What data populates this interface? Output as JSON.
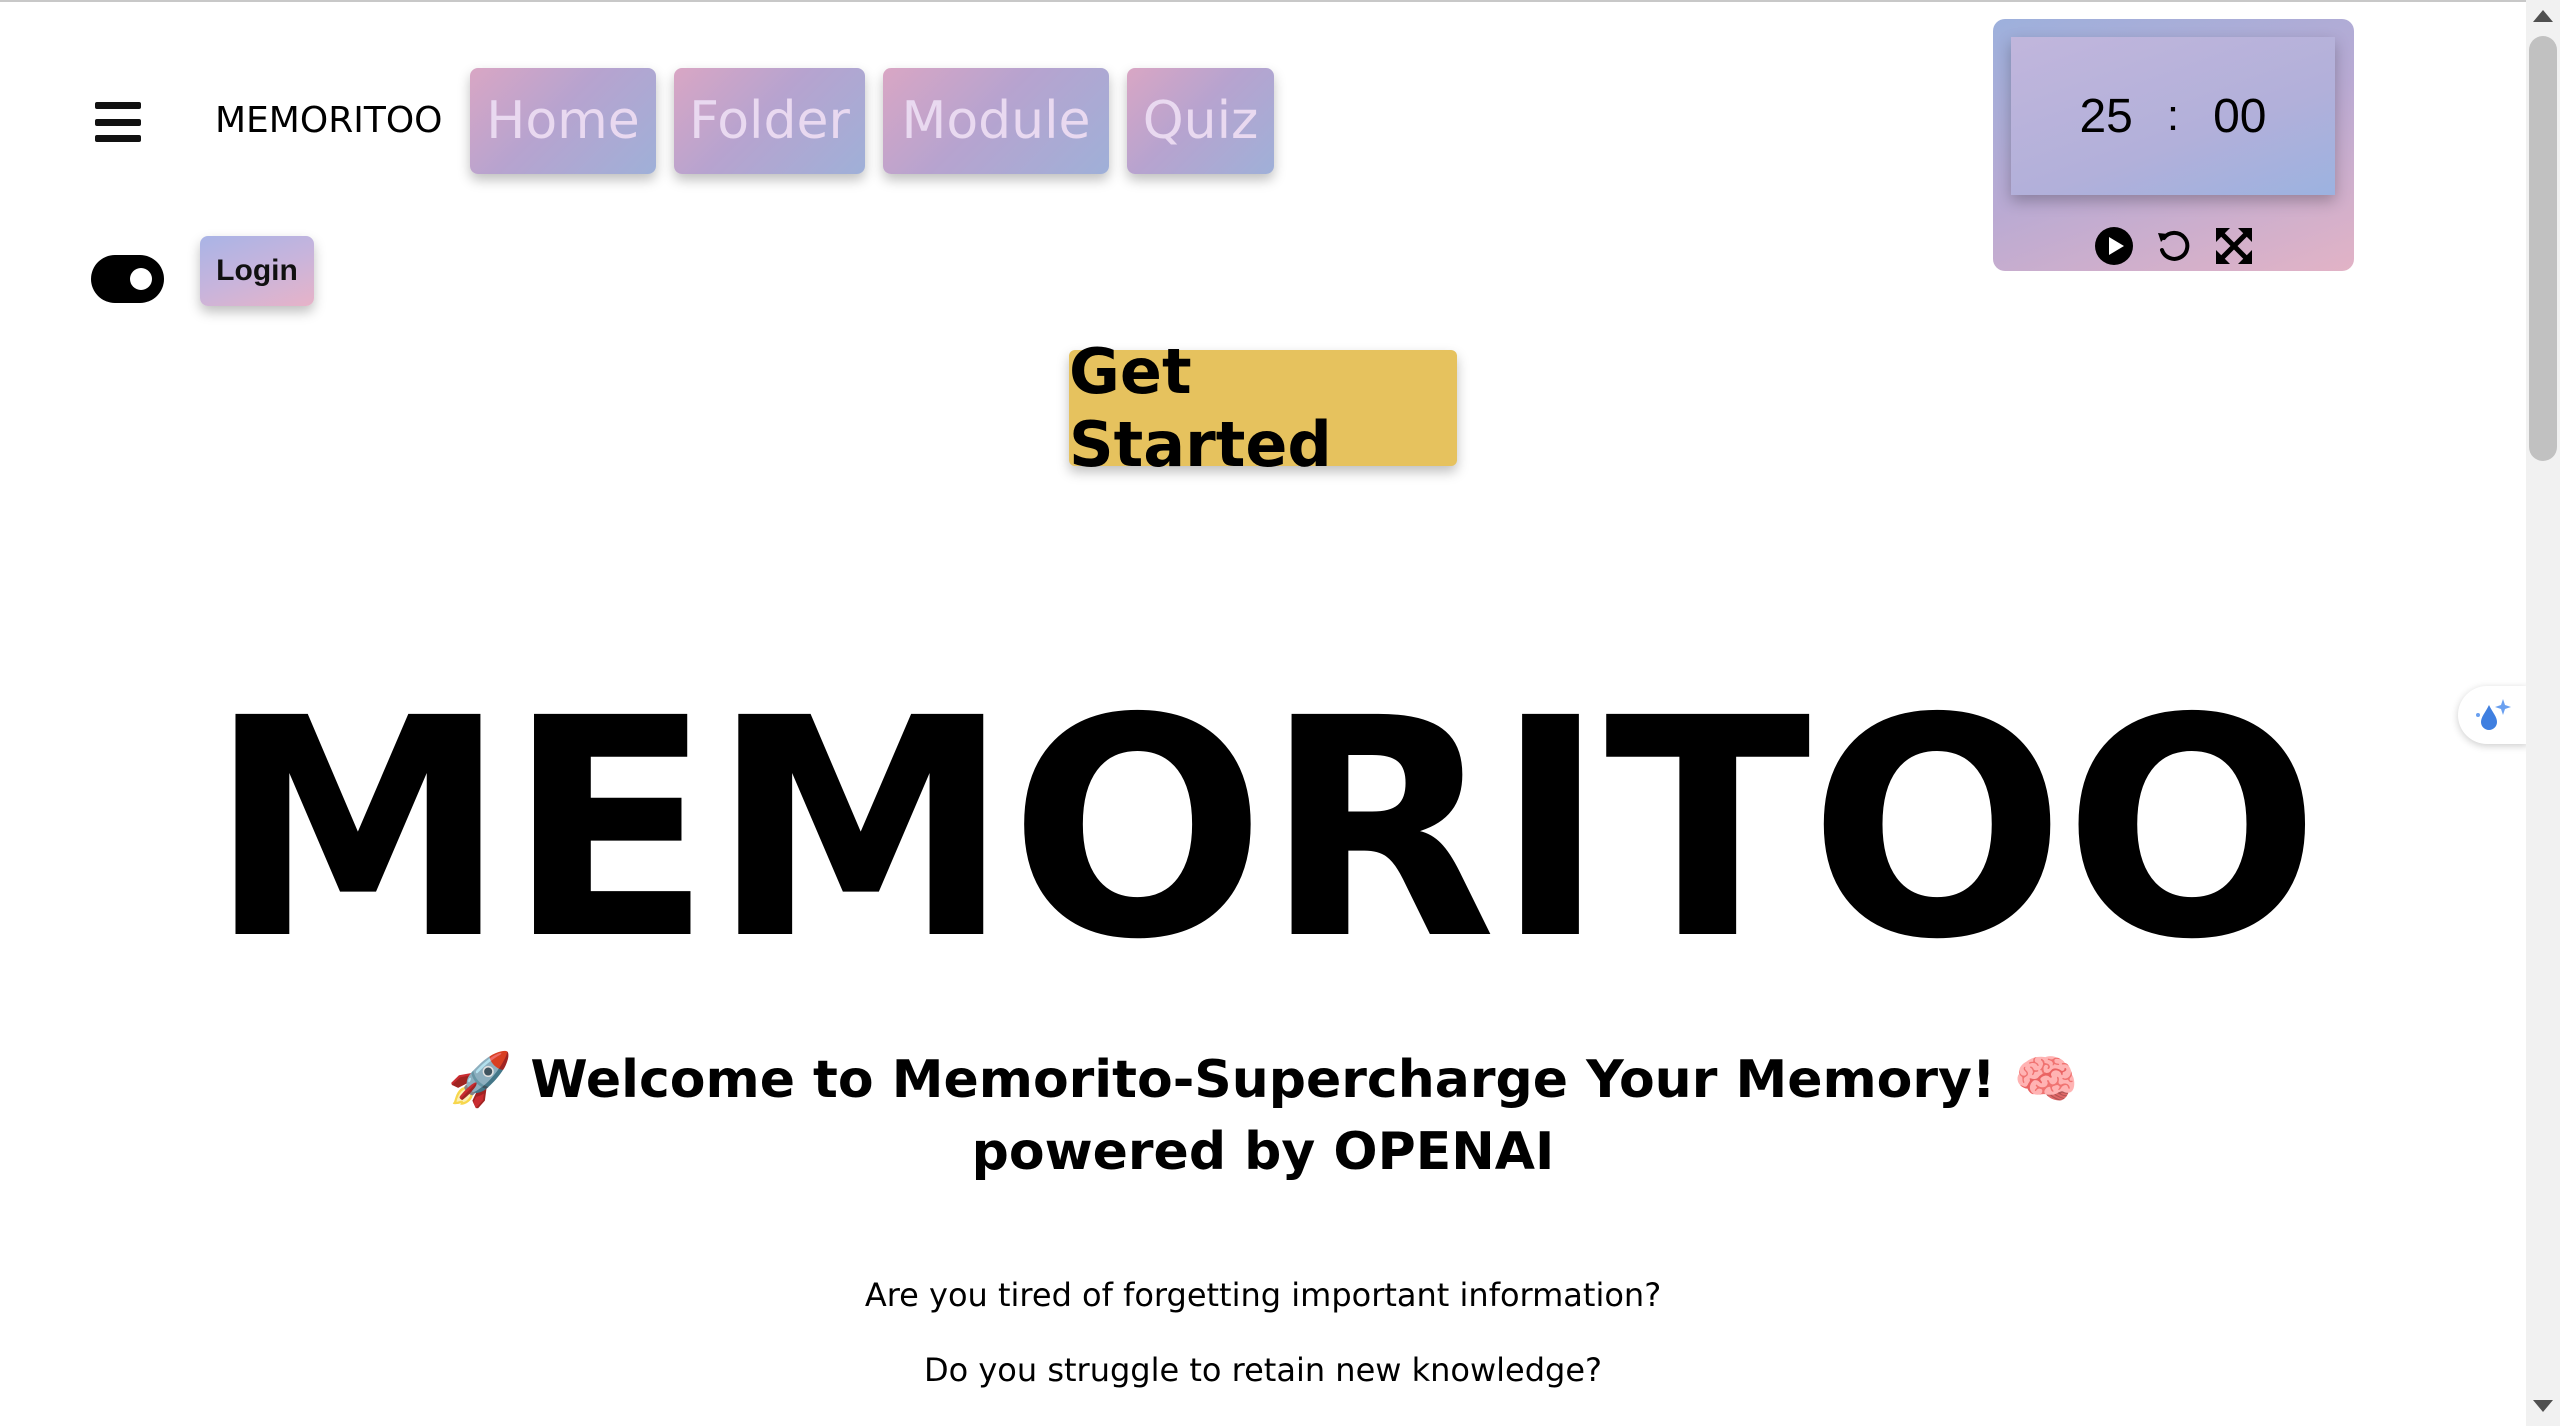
{
  "header": {
    "brand": "MEMORITOO",
    "nav": [
      "Home",
      "Folder",
      "Module",
      "Quiz"
    ],
    "login_label": "Login",
    "theme_toggle_on": true
  },
  "timer": {
    "minutes": "25",
    "separator": ":",
    "seconds": "00",
    "controls": [
      "play-icon",
      "reset-icon",
      "fullscreen-icon"
    ]
  },
  "cta": {
    "label": "Get Started",
    "color": "#e6c25e"
  },
  "hero": {
    "title": "MEMORITOO",
    "welcome_emoji_left": "🚀",
    "welcome_line1": "Welcome to Memorito-Supercharge Your Memory!",
    "welcome_emoji_right": "🧠",
    "welcome_line2": "powered by OPENAI",
    "paragraphs": [
      "Are you tired of forgetting important information?",
      "Do you struggle to retain new knowledge?"
    ]
  },
  "icons": {
    "menu": "hamburger-icon",
    "extension": "sparkle-drop-icon"
  }
}
